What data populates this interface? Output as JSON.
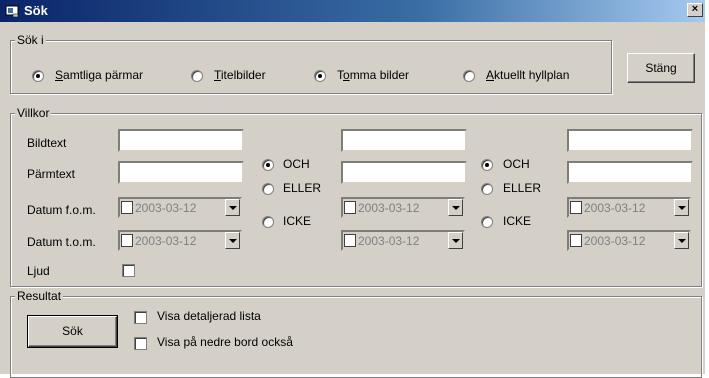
{
  "window": {
    "title": "Sök",
    "close_glyph": "×"
  },
  "sok_i": {
    "legend": "Sök i",
    "options": [
      {
        "pre": "",
        "key": "S",
        "post": "amtliga pärmar",
        "selected": true
      },
      {
        "pre": "",
        "key": "T",
        "post": "itelbilder",
        "selected": false
      },
      {
        "pre": "T",
        "key": "o",
        "post": "mma bilder",
        "selected": true
      },
      {
        "pre": "",
        "key": "A",
        "post": "ktuellt hyllplan",
        "selected": false
      }
    ],
    "close_button": "Stäng"
  },
  "villkor": {
    "legend": "Villkor",
    "labels": {
      "bildtext": "Bildtext",
      "parmtext": "Pärmtext",
      "datum_fom": "Datum f.o.m.",
      "datum_tom": "Datum t.o.m.",
      "ljud": "Ljud"
    },
    "operators": [
      [
        {
          "label": "OCH",
          "selected": true
        },
        {
          "label": "ELLER",
          "selected": false
        },
        {
          "label": "ICKE",
          "selected": false
        }
      ],
      [
        {
          "label": "OCH",
          "selected": true
        },
        {
          "label": "ELLER",
          "selected": false
        },
        {
          "label": "ICKE",
          "selected": false
        }
      ]
    ],
    "date_value": "2003-03-12"
  },
  "resultat": {
    "legend": "Resultat",
    "search_button": "Sök",
    "options": [
      {
        "label": "Visa detaljerad lista",
        "checked": false
      },
      {
        "label": "Visa på nedre bord också",
        "checked": false
      }
    ]
  }
}
